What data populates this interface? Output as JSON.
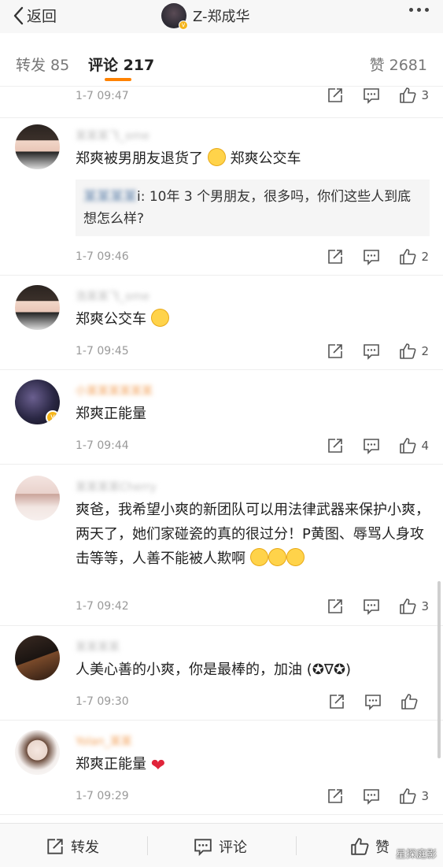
{
  "nav": {
    "back_label": "返回",
    "title": "Z-郑成华"
  },
  "tabs": {
    "repost": "转发 85",
    "comment": "评论 217",
    "like": "赞 2681"
  },
  "first_item": {
    "time": "1-7 09:47",
    "like_count": "3"
  },
  "comments": [
    {
      "name": "某某某飞_ome",
      "text": "郑爽被男朋友退货了",
      "text_tail": "郑爽公交车",
      "quote_name": "某某某某",
      "quote_text": "i: 10年 3 个男朋友，很多吗，你们这些人到底想怎么样?",
      "time": "1-7 09:46",
      "like_count": "2"
    },
    {
      "name": "浩某某飞_ome",
      "text": "郑爽公交车",
      "time": "1-7 09:45",
      "like_count": "2"
    },
    {
      "name": "小某某某某某某",
      "text": "郑爽正能量",
      "time": "1-7 09:44",
      "like_count": "4"
    },
    {
      "name": "某某某某Cherry",
      "text": "爽爸，我希望小爽的新团队可以用法律武器来保护小爽，两天了，她们家碰瓷的真的很过分！P黄图、辱骂人身攻击等等，人善不能被人欺啊",
      "time": "1-7 09:42",
      "like_count": "3"
    },
    {
      "name": "某某某某",
      "text": "人美心善的小爽，你是最棒的，加油 (✪∇✪)",
      "time": "1-7 09:30",
      "like_count": ""
    },
    {
      "name": "Yolan_某某",
      "text": "郑爽正能量",
      "time": "1-7 09:29",
      "like_count": "3"
    }
  ],
  "bottom": {
    "repost": "转发",
    "comment": "评论",
    "like": "赞",
    "watermark": "星探庭影"
  },
  "colors": {
    "accent": "#ff8200",
    "vip": "#f5b51c",
    "heart": "#e0243a"
  },
  "icons": [
    "chevron-left-icon",
    "more-icon",
    "share-icon",
    "comment-icon",
    "thumb-up-icon",
    "verified-icon",
    "laugh-emoji-icon",
    "hug-emoji-icon",
    "heart-emoji-icon"
  ]
}
